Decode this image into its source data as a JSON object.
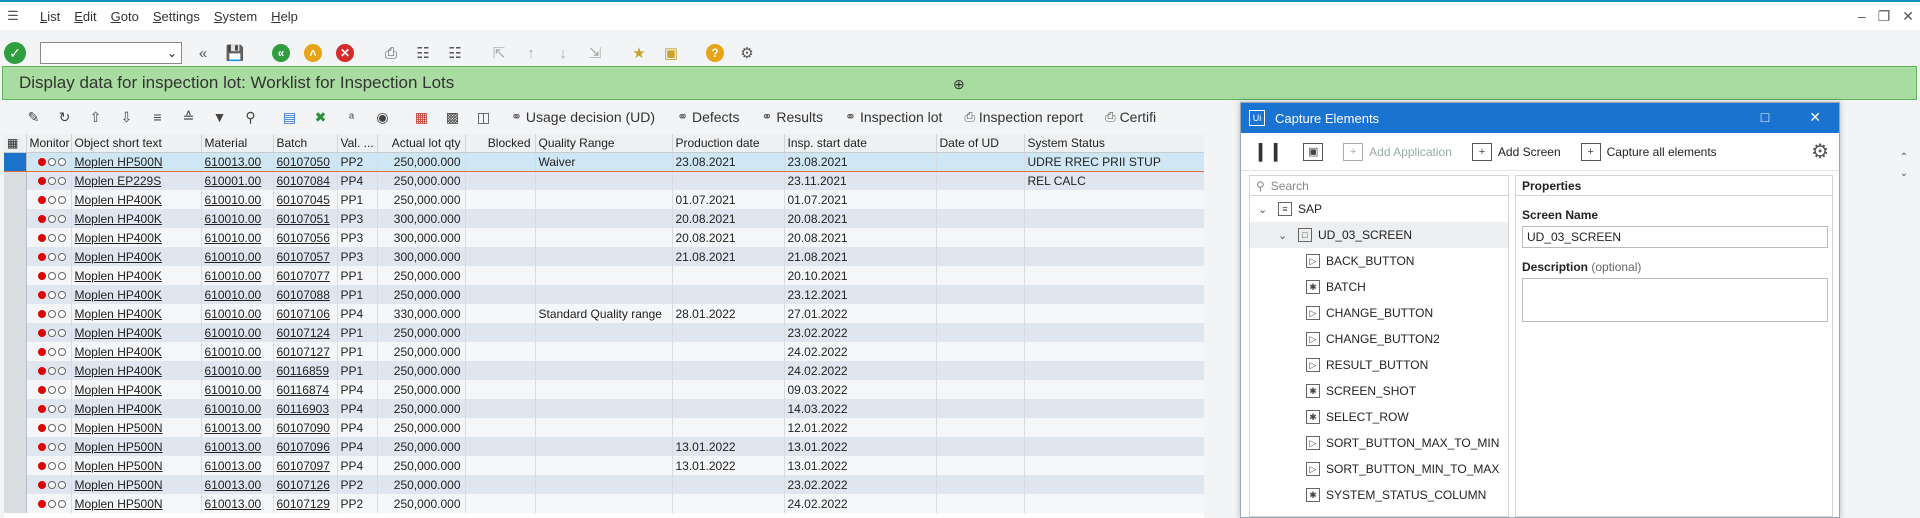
{
  "menu": [
    "List",
    "Edit",
    "Goto",
    "Settings",
    "System",
    "Help"
  ],
  "title": "Display data for inspection lot: Worklist for Inspection Lots",
  "app_toolbar": [
    "Usage decision (UD)",
    "Defects",
    "Results",
    "Inspection lot",
    "Inspection report",
    "Certifi"
  ],
  "columns": [
    "Monitor",
    "Object short text",
    "Material",
    "Batch",
    "Val. ...",
    "Actual lot qty",
    "Blocked",
    "Quality Range",
    "Production date",
    "Insp. start date",
    "Date of UD",
    "System Status"
  ],
  "rows": [
    [
      "Moplen HP500N",
      "610013.00",
      "60107050",
      "PP2",
      "250,000.000",
      "",
      "Waiver",
      "23.08.2021",
      "23.08.2021",
      "",
      "UDRE RREC PRII STUP"
    ],
    [
      "Moplen EP229S",
      "610001.00",
      "60107084",
      "PP4",
      "250,000.000",
      "",
      "",
      "",
      "23.11.2021",
      "",
      "REL  CALC"
    ],
    [
      "Moplen HP400K",
      "610010.00",
      "60107045",
      "PP1",
      "250,000.000",
      "",
      "",
      "01.07.2021",
      "01.07.2021",
      "",
      ""
    ],
    [
      "Moplen HP400K",
      "610010.00",
      "60107051",
      "PP3",
      "300,000.000",
      "",
      "",
      "20.08.2021",
      "20.08.2021",
      "",
      ""
    ],
    [
      "Moplen HP400K",
      "610010.00",
      "60107056",
      "PP3",
      "300,000.000",
      "",
      "",
      "20.08.2021",
      "20.08.2021",
      "",
      ""
    ],
    [
      "Moplen HP400K",
      "610010.00",
      "60107057",
      "PP3",
      "300,000.000",
      "",
      "",
      "21.08.2021",
      "21.08.2021",
      "",
      ""
    ],
    [
      "Moplen HP400K",
      "610010.00",
      "60107077",
      "PP1",
      "250,000.000",
      "",
      "",
      "",
      "20.10.2021",
      "",
      ""
    ],
    [
      "Moplen HP400K",
      "610010.00",
      "60107088",
      "PP1",
      "250,000.000",
      "",
      "",
      "",
      "23.12.2021",
      "",
      ""
    ],
    [
      "Moplen HP400K",
      "610010.00",
      "60107106",
      "PP4",
      "330,000.000",
      "",
      "Standard Quality range",
      "28.01.2022",
      "27.01.2022",
      "",
      ""
    ],
    [
      "Moplen HP400K",
      "610010.00",
      "60107124",
      "PP1",
      "250,000.000",
      "",
      "",
      "",
      "23.02.2022",
      "",
      ""
    ],
    [
      "Moplen HP400K",
      "610010.00",
      "60107127",
      "PP1",
      "250,000.000",
      "",
      "",
      "",
      "24.02.2022",
      "",
      ""
    ],
    [
      "Moplen HP400K",
      "610010.00",
      "60116859",
      "PP1",
      "250,000.000",
      "",
      "",
      "",
      "24.02.2022",
      "",
      ""
    ],
    [
      "Moplen HP400K",
      "610010.00",
      "60116874",
      "PP4",
      "250,000.000",
      "",
      "",
      "",
      "09.03.2022",
      "",
      ""
    ],
    [
      "Moplen HP400K",
      "610010.00",
      "60116903",
      "PP4",
      "250,000.000",
      "",
      "",
      "",
      "14.03.2022",
      "",
      ""
    ],
    [
      "Moplen HP500N",
      "610013.00",
      "60107090",
      "PP4",
      "250,000.000",
      "",
      "",
      "",
      "12.01.2022",
      "",
      ""
    ],
    [
      "Moplen HP500N",
      "610013.00",
      "60107096",
      "PP4",
      "250,000.000",
      "",
      "",
      "13.01.2022",
      "13.01.2022",
      "",
      ""
    ],
    [
      "Moplen HP500N",
      "610013.00",
      "60107097",
      "PP4",
      "250,000.000",
      "",
      "",
      "13.01.2022",
      "13.01.2022",
      "",
      ""
    ],
    [
      "Moplen HP500N",
      "610013.00",
      "60107126",
      "PP2",
      "250,000.000",
      "",
      "",
      "",
      "23.02.2022",
      "",
      ""
    ],
    [
      "Moplen HP500N",
      "610013.00",
      "60107129",
      "PP2",
      "250,000.000",
      "",
      "",
      "",
      "24.02.2022",
      "",
      ""
    ]
  ],
  "capture": {
    "title": "Capture Elements",
    "logo": "Ui",
    "add_application": "Add Application",
    "add_screen": "Add Screen",
    "capture_all": "Capture all elements",
    "search_placeholder": "Search",
    "root": "SAP",
    "screen": "UD_03_SCREEN",
    "elements": [
      "BACK_BUTTON",
      "BATCH",
      "CHANGE_BUTTON",
      "CHANGE_BUTTON2",
      "RESULT_BUTTON",
      "SCREEN_SHOT",
      "SELECT_ROW",
      "SORT_BUTTON_MAX_TO_MIN",
      "SORT_BUTTON_MIN_TO_MAX",
      "SYSTEM_STATUS_COLUMN"
    ],
    "element_icons": [
      "btn",
      "field",
      "btn",
      "btn",
      "btn",
      "field",
      "field",
      "btn",
      "btn",
      "field"
    ],
    "properties_header": "Properties",
    "screen_name_label": "Screen Name",
    "screen_name_value": "UD_03_SCREEN",
    "description_label": "Description",
    "description_hint": "(optional)"
  }
}
